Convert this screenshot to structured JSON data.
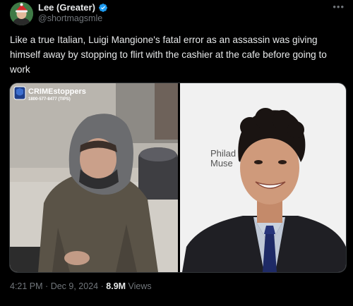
{
  "author": {
    "name": "Lee (Greater)",
    "handle": "@shortmagsmle",
    "verified": true,
    "verified_color": "#1d9bf0"
  },
  "more_icon": "more-horizontal-icon",
  "tweet_text": "Like a true Italian, Luigi Mangione's fatal error as an assassin was giving himself away by stopping to flirt with the cashier at the cafe before going to work",
  "media": {
    "left_image": {
      "watermark_brand": "CRIMEstoppers",
      "watermark_phone": "1800-577-8477 (TIPS)"
    },
    "right_image": {
      "backdrop_text": [
        "Philad",
        "Muse"
      ]
    }
  },
  "meta": {
    "time": "4:21 PM",
    "separator": "·",
    "date": "Dec 9, 2024",
    "views_count": "8.9M",
    "views_label": "Views"
  },
  "colors": {
    "background": "#000000",
    "text_primary": "#e7e9ea",
    "text_secondary": "#71767b"
  }
}
